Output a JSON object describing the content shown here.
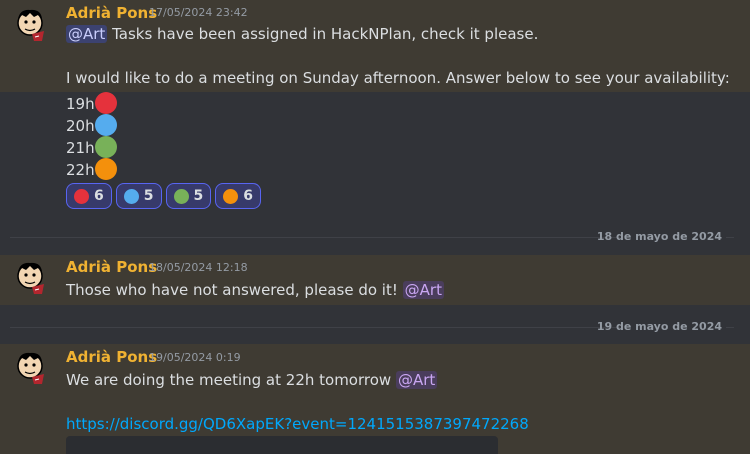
{
  "messages": [
    {
      "author": "Adrià Pons",
      "timestamp": "17/05/2024 23:42",
      "mention": "@Art",
      "text1": "Tasks have been assigned in HackNPlan, check it please.",
      "text2": "I would like to do a meeting on Sunday afternoon. Answer below to see your availability:",
      "options": [
        {
          "label": "19h",
          "color": "#e5323c"
        },
        {
          "label": "20h",
          "color": "#55acee"
        },
        {
          "label": "21h",
          "color": "#78b159"
        },
        {
          "label": "22h",
          "color": "#f4900c"
        }
      ],
      "reactions": [
        {
          "color": "#e5323c",
          "count": "6"
        },
        {
          "color": "#55acee",
          "count": "5"
        },
        {
          "color": "#78b159",
          "count": "5"
        },
        {
          "color": "#f4900c",
          "count": "6"
        }
      ]
    },
    {
      "author": "Adrià Pons",
      "timestamp": "18/05/2024 12:18",
      "text": "Those who have not answered, please do it!",
      "mention": "@Art"
    },
    {
      "author": "Adrià Pons",
      "timestamp": "19/05/2024 0:19",
      "text": "We are doing the meeting at 22h tomorrow",
      "mention": "@Art",
      "link": "https://discord.gg/QD6XapEK?event=1241515387397472268"
    }
  ],
  "dividers": [
    "18 de mayo de 2024",
    "19 de mayo de 2024"
  ]
}
